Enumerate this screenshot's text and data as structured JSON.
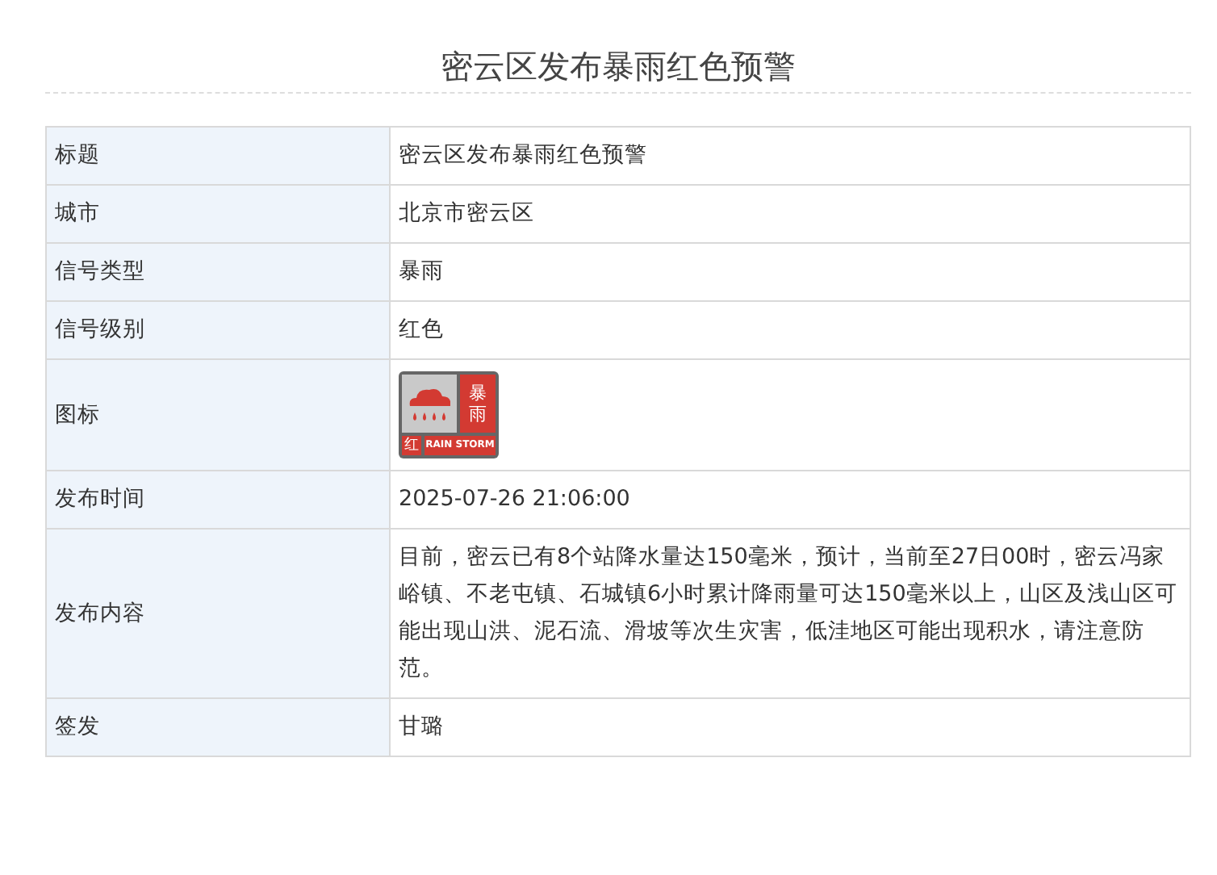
{
  "page_title": "密云区发布暴雨红色预警",
  "rows": [
    {
      "kind": "text",
      "label": "标题",
      "value": "密云区发布暴雨红色预警"
    },
    {
      "kind": "text",
      "label": "城市",
      "value": "北京市密云区"
    },
    {
      "kind": "text",
      "label": "信号类型",
      "value": "暴雨"
    },
    {
      "kind": "text",
      "label": "信号级别",
      "value": "红色"
    },
    {
      "kind": "signal",
      "label": "图标",
      "signal": {
        "type_top": "暴",
        "type_bottom": "雨",
        "level": "红",
        "caption": "RAIN STORM"
      }
    },
    {
      "kind": "text",
      "label": "发布时间",
      "value": "2025-07-26 21:06:00"
    },
    {
      "kind": "text",
      "label": "发布内容",
      "value": "目前，密云已有8个站降水量达150毫米，预计，当前至27日00时，密云冯家峪镇、不老屯镇、石城镇6小时累计降雨量可达150毫米以上，山区及浅山区可能出现山洪、泥石流、滑坡等次生灾害，低洼地区可能出现积水，请注意防范。"
    },
    {
      "kind": "text",
      "label": "签发",
      "value": "甘璐"
    }
  ]
}
